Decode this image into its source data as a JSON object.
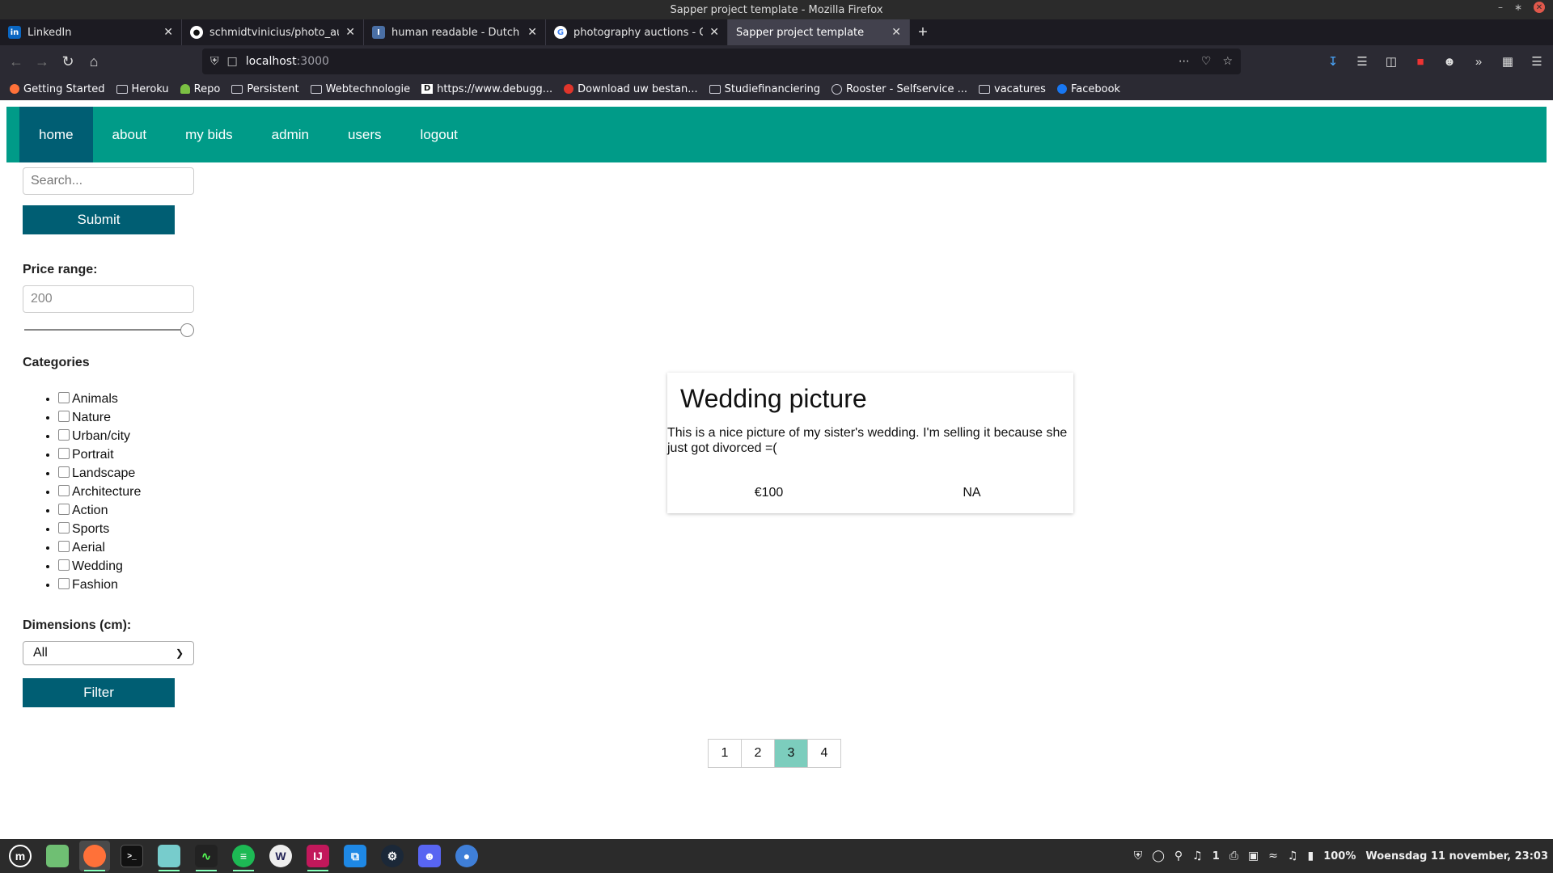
{
  "window": {
    "title": "Sapper project template - Mozilla Firefox"
  },
  "tabs": [
    {
      "title": "LinkedIn",
      "icon": "linkedin-icon",
      "active": false
    },
    {
      "title": "schmidtvinicius/photo_auc",
      "icon": "github-icon",
      "active": false
    },
    {
      "title": "human readable - Dutch tra",
      "icon": "dictionary-icon",
      "active": false
    },
    {
      "title": "photography auctions - Goo",
      "icon": "google-icon",
      "active": false
    },
    {
      "title": "Sapper project template",
      "icon": "",
      "active": true
    }
  ],
  "urlbar": {
    "host": "localhost",
    "port": ":3000"
  },
  "bookmarks": [
    {
      "label": "Getting Started",
      "icon": "firefox-icon"
    },
    {
      "label": "Heroku",
      "icon": "folder-icon"
    },
    {
      "label": "Repo",
      "icon": "android-icon"
    },
    {
      "label": "Persistent",
      "icon": "folder-icon"
    },
    {
      "label": "Webtechnologie",
      "icon": "folder-icon"
    },
    {
      "label": "https://www.debugg...",
      "icon": "d-icon"
    },
    {
      "label": "Download uw bestan...",
      "icon": "download-icon"
    },
    {
      "label": "Studiefinanciering",
      "icon": "folder-icon"
    },
    {
      "label": "Rooster - Selfservice ...",
      "icon": "globe-icon"
    },
    {
      "label": "vacatures",
      "icon": "folder-icon"
    },
    {
      "label": "Facebook",
      "icon": "facebook-icon"
    }
  ],
  "sitenav": {
    "items": [
      "home",
      "about",
      "my bids",
      "admin",
      "users",
      "logout"
    ],
    "active": "home"
  },
  "sidebar": {
    "search_placeholder": "Search...",
    "submit_label": "Submit",
    "price_label": "Price range:",
    "price_placeholder": "200",
    "price_slider_value": 1.0,
    "categories_label": "Categories",
    "categories": [
      "Animals",
      "Nature",
      "Urban/city",
      "Portrait",
      "Landscape",
      "Architecture",
      "Action",
      "Sports",
      "Aerial",
      "Wedding",
      "Fashion"
    ],
    "dimensions_label": "Dimensions (cm):",
    "dimensions_value": "All",
    "filter_label": "Filter"
  },
  "listing": {
    "title": "Wedding picture",
    "description": "This is a nice picture of my sister's wedding. I'm selling it because she just got divorced =(",
    "price": "€100",
    "status": "NA"
  },
  "pagination": {
    "pages": [
      "1",
      "2",
      "3",
      "4"
    ],
    "active": "3"
  },
  "taskbar": {
    "battery": "100%",
    "clock": "Woensdag 11 november, 23:03",
    "notifications": "1"
  },
  "colors": {
    "nav": "#009b88",
    "nav_active": "#005e73",
    "button": "#005e73",
    "page_active": "#7ccdbd"
  }
}
